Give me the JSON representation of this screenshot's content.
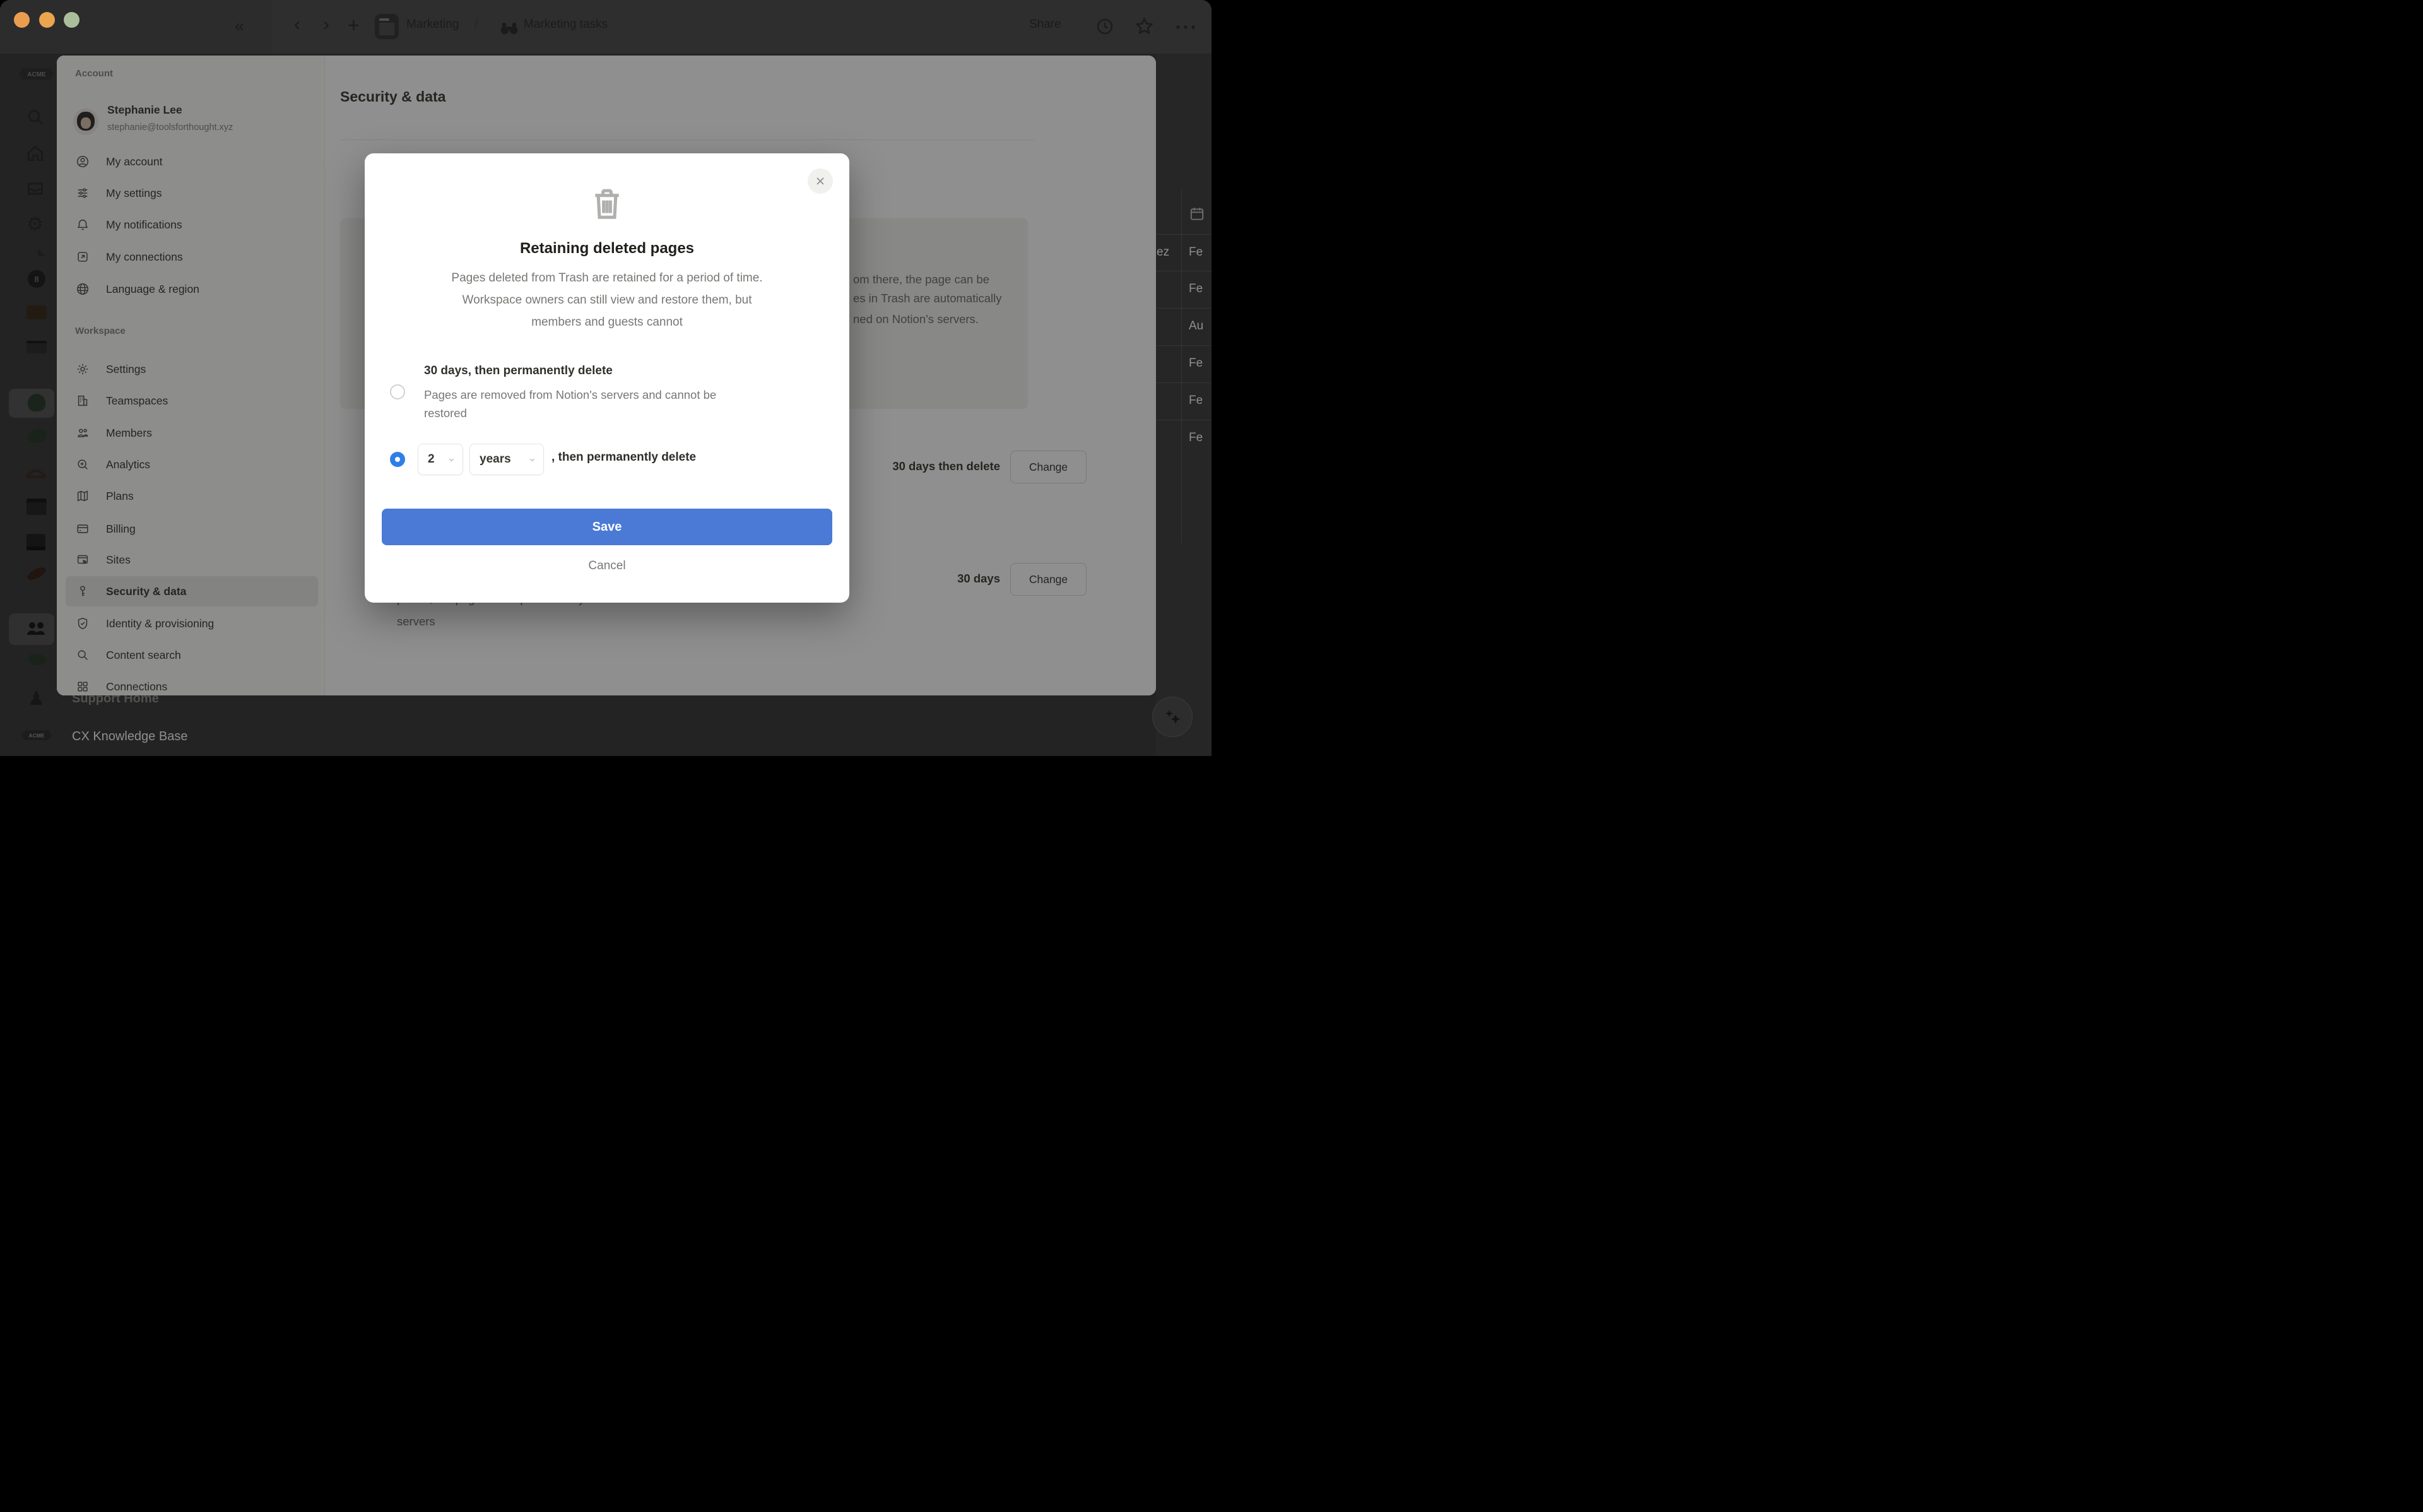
{
  "topbar": {
    "breadcrumb_parent": "Marketing",
    "breadcrumb_divider": "/",
    "breadcrumb_current": "Marketing tasks",
    "share_label": "Share"
  },
  "app_sidebar": {
    "workspace_badge": "ACME",
    "bottom_items": [
      {
        "label": "Support Home"
      },
      {
        "label": "CX Knowledge Base"
      }
    ]
  },
  "settings": {
    "account_section": "Account",
    "user": {
      "name": "Stephanie Lee",
      "email": "stephanie@toolsforthought.xyz"
    },
    "account_items": [
      {
        "label": "My account"
      },
      {
        "label": "My settings"
      },
      {
        "label": "My notifications"
      },
      {
        "label": "My connections"
      },
      {
        "label": "Language & region"
      }
    ],
    "workspace_section": "Workspace",
    "workspace_items": [
      {
        "label": "Settings"
      },
      {
        "label": "Teamspaces"
      },
      {
        "label": "Members"
      },
      {
        "label": "Analytics"
      },
      {
        "label": "Plans"
      },
      {
        "label": "Billing"
      },
      {
        "label": "Sites"
      },
      {
        "label": "Security & data"
      },
      {
        "label": "Identity & provisioning"
      },
      {
        "label": "Content search"
      },
      {
        "label": "Connections"
      }
    ],
    "selected_item": "Security & data"
  },
  "content": {
    "heading": "Security & data",
    "info_box_lines": [
      "om there, the page can be",
      "es in Trash are automatically",
      "ned on Notion's servers."
    ],
    "retention_rows": [
      {
        "value": "30 days then delete",
        "button_label": "Change"
      },
      {
        "value": "30 days",
        "button_label": "Change"
      }
    ],
    "footer_lines": [
      "period, the page will be permanently deleted from Notion's",
      "servers"
    ]
  },
  "dialog": {
    "title": "Retaining deleted pages",
    "description_lines": [
      "Pages deleted from Trash are retained for a period of time.",
      "Workspace owners can still view and restore them, but",
      "members and guests cannot"
    ],
    "option_30_days": {
      "label": "30 days, then permanently delete",
      "description_lines": [
        "Pages are removed from Notion's servers and cannot be",
        "restored"
      ]
    },
    "option_custom": {
      "duration_value": "2",
      "duration_unit": "years",
      "suffix": ", then permanently delete"
    },
    "save_label": "Save",
    "cancel_label": "Cancel"
  },
  "right_table": {
    "rows": [
      {
        "name_fragment": "ez",
        "date_fragment": "Fe"
      },
      {
        "name_fragment": "",
        "date_fragment": "Fe"
      },
      {
        "name_fragment": "",
        "date_fragment": "Au"
      },
      {
        "name_fragment": "",
        "date_fragment": "Fe"
      },
      {
        "name_fragment": "",
        "date_fragment": "Fe"
      },
      {
        "name_fragment": "",
        "date_fragment": "Fe"
      }
    ]
  },
  "colors": {
    "radio_blue": "#2e7fe8",
    "save_blue": "#4a7ad6",
    "traffic_lights": [
      "#eb9d4f",
      "#eba44f",
      "#abbe9b"
    ]
  }
}
